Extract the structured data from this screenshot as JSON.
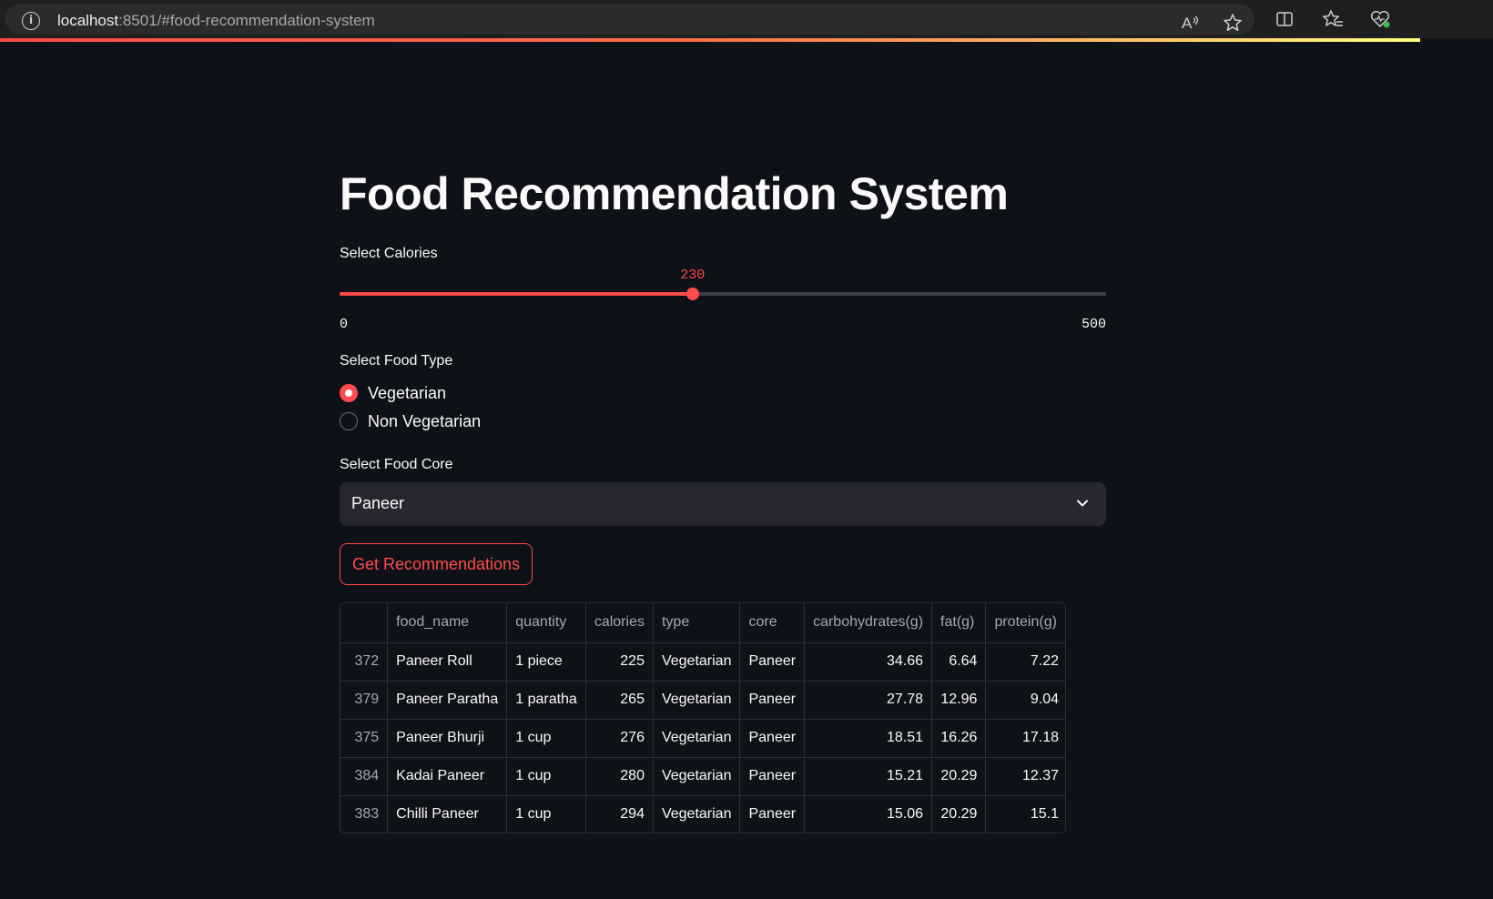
{
  "browser": {
    "url_host": "localhost",
    "url_rest": ":8501/#food-recommendation-system"
  },
  "app": {
    "title": "Food Recommendation System",
    "calories": {
      "label": "Select Calories",
      "value": "230",
      "min": "0",
      "max": "500"
    },
    "food_type": {
      "label": "Select Food Type",
      "options": [
        {
          "label": "Vegetarian",
          "selected": true
        },
        {
          "label": "Non Vegetarian",
          "selected": false
        }
      ]
    },
    "food_core": {
      "label": "Select Food Core",
      "selected": "Paneer"
    },
    "button_label": "Get Recommendations",
    "table": {
      "columns": [
        "",
        "food_name",
        "quantity",
        "calories",
        "type",
        "core",
        "carbohydrates(g)",
        "fat(g)",
        "protein(g)"
      ],
      "rows": [
        [
          "372",
          "Paneer Roll",
          "1 piece",
          "225",
          "Vegetarian",
          "Paneer",
          "34.66",
          "6.64",
          "7.22"
        ],
        [
          "379",
          "Paneer Paratha",
          "1 paratha",
          "265",
          "Vegetarian",
          "Paneer",
          "27.78",
          "12.96",
          "9.04"
        ],
        [
          "375",
          "Paneer Bhurji",
          "1 cup",
          "276",
          "Vegetarian",
          "Paneer",
          "18.51",
          "16.26",
          "17.18"
        ],
        [
          "384",
          "Kadai Paneer",
          "1 cup",
          "280",
          "Vegetarian",
          "Paneer",
          "15.21",
          "20.29",
          "12.37"
        ],
        [
          "383",
          "Chilli Paneer",
          "1 cup",
          "294",
          "Vegetarian",
          "Paneer",
          "15.06",
          "20.29",
          "15.1"
        ]
      ]
    }
  },
  "colors": {
    "accent": "#ff4b4b",
    "background": "#0e1117",
    "input_bg": "#262730"
  },
  "icons": [
    "info-icon",
    "read-aloud-icon",
    "favorite-star-icon",
    "split-screen-icon",
    "favorites-icon",
    "browser-essentials-icon",
    "chevron-down-icon"
  ]
}
